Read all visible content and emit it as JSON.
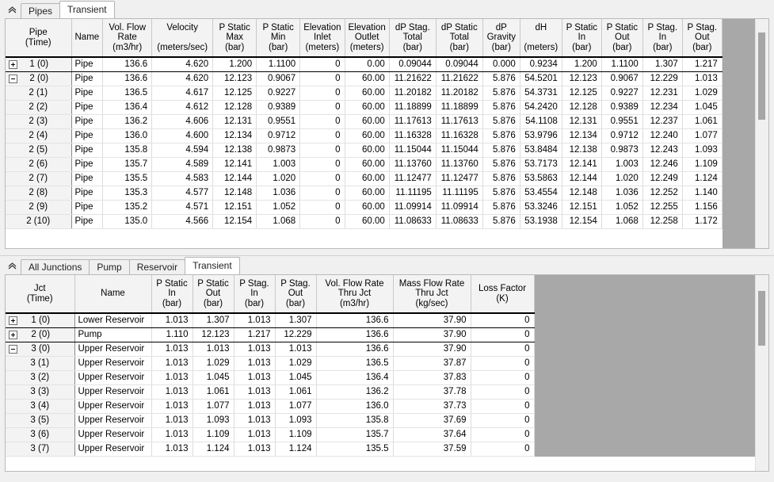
{
  "window": {
    "background": "#f0f0f0",
    "accent": "#ffffff"
  },
  "top_panel": {
    "collapse_icon": "chevron-up-icon",
    "tabs": [
      {
        "label": "Pipes",
        "active": false
      },
      {
        "label": "Transient",
        "active": true
      }
    ],
    "table": {
      "columns": [
        "Pipe\n(Time)",
        "Name",
        "Vol. Flow\nRate\n(m3/hr)",
        "Velocity\n\n(meters/sec)",
        "P Static\nMax\n(bar)",
        "P Static\nMin\n(bar)",
        "Elevation\nInlet\n(meters)",
        "Elevation\nOutlet\n(meters)",
        "dP Stag.\nTotal\n(bar)",
        "dP Static\nTotal\n(bar)",
        "dP\nGravity\n(bar)",
        "dH\n\n(meters)",
        "P Static\nIn\n(bar)",
        "P Static\nOut\n(bar)",
        "P Stag.\nIn\n(bar)",
        "P Stag.\nOut\n(bar)"
      ],
      "rows": [
        {
          "id": "1 (0)",
          "expander": "plus",
          "group": true,
          "cells": [
            "Pipe",
            "136.6",
            "4.620",
            "1.200",
            "1.1100",
            "0",
            "0.00",
            "0.09044",
            "0.09044",
            "0.000",
            "0.9234",
            "1.200",
            "1.1100",
            "1.307",
            "1.217"
          ]
        },
        {
          "id": "2 (0)",
          "expander": "minus",
          "group": false,
          "cells": [
            "Pipe",
            "136.6",
            "4.620",
            "12.123",
            "0.9067",
            "0",
            "60.00",
            "11.21622",
            "11.21622",
            "5.876",
            "54.5201",
            "12.123",
            "0.9067",
            "12.229",
            "1.013"
          ]
        },
        {
          "id": "2 (1)",
          "expander": "none",
          "group": false,
          "cells": [
            "Pipe",
            "136.5",
            "4.617",
            "12.125",
            "0.9227",
            "0",
            "60.00",
            "11.20182",
            "11.20182",
            "5.876",
            "54.3731",
            "12.125",
            "0.9227",
            "12.231",
            "1.029"
          ]
        },
        {
          "id": "2 (2)",
          "expander": "none",
          "group": false,
          "cells": [
            "Pipe",
            "136.4",
            "4.612",
            "12.128",
            "0.9389",
            "0",
            "60.00",
            "11.18899",
            "11.18899",
            "5.876",
            "54.2420",
            "12.128",
            "0.9389",
            "12.234",
            "1.045"
          ]
        },
        {
          "id": "2 (3)",
          "expander": "none",
          "group": false,
          "cells": [
            "Pipe",
            "136.2",
            "4.606",
            "12.131",
            "0.9551",
            "0",
            "60.00",
            "11.17613",
            "11.17613",
            "5.876",
            "54.1108",
            "12.131",
            "0.9551",
            "12.237",
            "1.061"
          ]
        },
        {
          "id": "2 (4)",
          "expander": "none",
          "group": false,
          "cells": [
            "Pipe",
            "136.0",
            "4.600",
            "12.134",
            "0.9712",
            "0",
            "60.00",
            "11.16328",
            "11.16328",
            "5.876",
            "53.9796",
            "12.134",
            "0.9712",
            "12.240",
            "1.077"
          ]
        },
        {
          "id": "2 (5)",
          "expander": "none",
          "group": false,
          "cells": [
            "Pipe",
            "135.8",
            "4.594",
            "12.138",
            "0.9873",
            "0",
            "60.00",
            "11.15044",
            "11.15044",
            "5.876",
            "53.8484",
            "12.138",
            "0.9873",
            "12.243",
            "1.093"
          ]
        },
        {
          "id": "2 (6)",
          "expander": "none",
          "group": false,
          "cells": [
            "Pipe",
            "135.7",
            "4.589",
            "12.141",
            "1.003",
            "0",
            "60.00",
            "11.13760",
            "11.13760",
            "5.876",
            "53.7173",
            "12.141",
            "1.003",
            "12.246",
            "1.109"
          ]
        },
        {
          "id": "2 (7)",
          "expander": "none",
          "group": false,
          "cells": [
            "Pipe",
            "135.5",
            "4.583",
            "12.144",
            "1.020",
            "0",
            "60.00",
            "11.12477",
            "11.12477",
            "5.876",
            "53.5863",
            "12.144",
            "1.020",
            "12.249",
            "1.124"
          ]
        },
        {
          "id": "2 (8)",
          "expander": "none",
          "group": false,
          "cells": [
            "Pipe",
            "135.3",
            "4.577",
            "12.148",
            "1.036",
            "0",
            "60.00",
            "11.11195",
            "11.11195",
            "5.876",
            "53.4554",
            "12.148",
            "1.036",
            "12.252",
            "1.140"
          ]
        },
        {
          "id": "2 (9)",
          "expander": "none",
          "group": false,
          "cells": [
            "Pipe",
            "135.2",
            "4.571",
            "12.151",
            "1.052",
            "0",
            "60.00",
            "11.09914",
            "11.09914",
            "5.876",
            "53.3246",
            "12.151",
            "1.052",
            "12.255",
            "1.156"
          ]
        },
        {
          "id": "2 (10)",
          "expander": "none",
          "group": false,
          "cells": [
            "Pipe",
            "135.0",
            "4.566",
            "12.154",
            "1.068",
            "0",
            "60.00",
            "11.08633",
            "11.08633",
            "5.876",
            "53.1938",
            "12.154",
            "1.068",
            "12.258",
            "1.172"
          ]
        }
      ]
    },
    "scrollbar": {
      "name": "vertical-scrollbar",
      "thumb_top_pct": 6,
      "thumb_height_pct": 38
    }
  },
  "bottom_panel": {
    "collapse_icon": "chevron-up-icon",
    "tabs": [
      {
        "label": "All Junctions",
        "active": false
      },
      {
        "label": "Pump",
        "active": false
      },
      {
        "label": "Reservoir",
        "active": false
      },
      {
        "label": "Transient",
        "active": true
      }
    ],
    "table": {
      "columns": [
        "Jct\n(Time)",
        "Name",
        "P Static\nIn\n(bar)",
        "P Static\nOut\n(bar)",
        "P Stag.\nIn\n(bar)",
        "P Stag.\nOut\n(bar)",
        "Vol. Flow Rate\nThru Jct\n(m3/hr)",
        "Mass Flow Rate\nThru Jct\n(kg/sec)",
        "Loss Factor\n(K)"
      ],
      "rows": [
        {
          "id": "1 (0)",
          "expander": "plus",
          "group": true,
          "cells": [
            "Lower Reservoir",
            "1.013",
            "1.307",
            "1.013",
            "1.307",
            "136.6",
            "37.90",
            "0"
          ]
        },
        {
          "id": "2 (0)",
          "expander": "plus",
          "group": true,
          "cells": [
            "Pump",
            "1.110",
            "12.123",
            "1.217",
            "12.229",
            "136.6",
            "37.90",
            "0"
          ]
        },
        {
          "id": "3 (0)",
          "expander": "minus",
          "group": false,
          "cells": [
            "Upper Reservoir",
            "1.013",
            "1.013",
            "1.013",
            "1.013",
            "136.6",
            "37.90",
            "0"
          ]
        },
        {
          "id": "3 (1)",
          "expander": "none",
          "group": false,
          "cells": [
            "Upper Reservoir",
            "1.013",
            "1.029",
            "1.013",
            "1.029",
            "136.5",
            "37.87",
            "0"
          ]
        },
        {
          "id": "3 (2)",
          "expander": "none",
          "group": false,
          "cells": [
            "Upper Reservoir",
            "1.013",
            "1.045",
            "1.013",
            "1.045",
            "136.4",
            "37.83",
            "0"
          ]
        },
        {
          "id": "3 (3)",
          "expander": "none",
          "group": false,
          "cells": [
            "Upper Reservoir",
            "1.013",
            "1.061",
            "1.013",
            "1.061",
            "136.2",
            "37.78",
            "0"
          ]
        },
        {
          "id": "3 (4)",
          "expander": "none",
          "group": false,
          "cells": [
            "Upper Reservoir",
            "1.013",
            "1.077",
            "1.013",
            "1.077",
            "136.0",
            "37.73",
            "0"
          ]
        },
        {
          "id": "3 (5)",
          "expander": "none",
          "group": false,
          "cells": [
            "Upper Reservoir",
            "1.013",
            "1.093",
            "1.013",
            "1.093",
            "135.8",
            "37.69",
            "0"
          ]
        },
        {
          "id": "3 (6)",
          "expander": "none",
          "group": false,
          "cells": [
            "Upper Reservoir",
            "1.013",
            "1.109",
            "1.013",
            "1.109",
            "135.7",
            "37.64",
            "0"
          ]
        },
        {
          "id": "3 (7)",
          "expander": "none",
          "group": false,
          "cells": [
            "Upper Reservoir",
            "1.013",
            "1.124",
            "1.013",
            "1.124",
            "135.5",
            "37.59",
            "0"
          ]
        }
      ]
    },
    "scrollbar": {
      "name": "vertical-scrollbar",
      "thumb_top_pct": 8,
      "thumb_height_pct": 28
    }
  }
}
